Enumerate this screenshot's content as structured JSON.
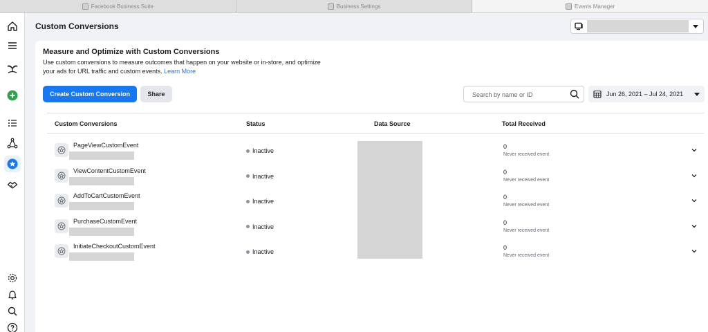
{
  "browser_tabs": [
    {
      "label": "Facebook Business Suite",
      "active": false
    },
    {
      "label": "Business Settings",
      "active": false
    },
    {
      "label": "Events Manager",
      "active": true
    }
  ],
  "rail": {
    "items": [
      {
        "icon": "home-icon"
      },
      {
        "icon": "menu-icon"
      },
      {
        "icon": "business-logo-icon"
      },
      {
        "icon": "add-icon",
        "color": "#31a24c"
      },
      {
        "icon": "list-icon"
      },
      {
        "icon": "connections-icon"
      },
      {
        "icon": "custom-conversions-icon",
        "active": true
      },
      {
        "icon": "partner-icon"
      }
    ],
    "bottom_items": [
      {
        "icon": "settings-icon"
      },
      {
        "icon": "notifications-icon"
      },
      {
        "icon": "search-icon"
      },
      {
        "icon": "help-icon"
      }
    ]
  },
  "header": {
    "title": "Custom Conversions",
    "account_icon": "ad-account-icon"
  },
  "intro": {
    "heading": "Measure and Optimize with Custom Conversions",
    "description": "Use custom conversions to measure outcomes that happen on your website or in-store, and optimize your ads for URL traffic and custom events.",
    "learn_more": "Learn More"
  },
  "toolbar": {
    "create_label": "Create Custom Conversion",
    "share_label": "Share",
    "search_placeholder": "Search by name or ID",
    "date_range": "Jun 26, 2021 – Jul 24, 2021"
  },
  "table": {
    "columns": {
      "name": "Custom Conversions",
      "status": "Status",
      "source": "Data Source",
      "total": "Total Received"
    },
    "rows": [
      {
        "name": "PageViewCustomEvent",
        "status": "Inactive",
        "total": "0",
        "note": "Never received event"
      },
      {
        "name": "ViewContentCustomEvent",
        "status": "Inactive",
        "total": "0",
        "note": "Never received event"
      },
      {
        "name": "AddToCartCustomEvent",
        "status": "Inactive",
        "total": "0",
        "note": "Never received event"
      },
      {
        "name": "PurchaseCustomEvent",
        "status": "Inactive",
        "total": "0",
        "note": "Never received event"
      },
      {
        "name": "InitiateCheckoutCustomEvent",
        "status": "Inactive",
        "total": "0",
        "note": "Never received event"
      }
    ]
  },
  "colors": {
    "accent": "#1877f2",
    "inactive_dot": "#8d949e"
  }
}
